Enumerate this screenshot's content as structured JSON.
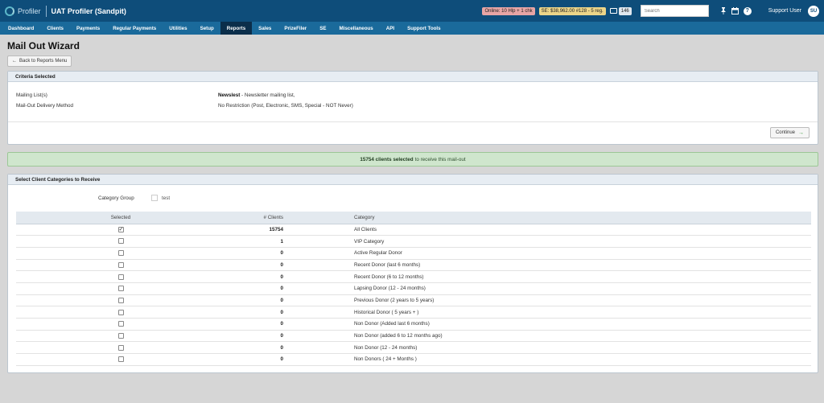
{
  "topbar": {
    "brand": "Profiler",
    "title": "UAT Profiler (Sandpit)",
    "online_badge": "Online: 10 Hlp + 1 chk",
    "se_badge": "SE: $38,962.00 #128 - 5 reg.",
    "message_count": "146",
    "search_placeholder": "Search",
    "user_name": "Support User",
    "user_initials": "SU"
  },
  "nav": {
    "items": [
      "Dashboard",
      "Clients",
      "Payments",
      "Regular Payments",
      "Utilities",
      "Setup",
      "Reports",
      "Sales",
      "PrizeFiler",
      "SE",
      "Miscellaneous",
      "API",
      "Support Tools"
    ],
    "active": "Reports"
  },
  "page": {
    "title": "Mail Out Wizard",
    "back_label": "Back to Reports Menu"
  },
  "criteria": {
    "heading": "Criteria Selected",
    "mailing_label": "Mailing List(s)",
    "mailing_name": "Newslest",
    "mailing_desc": " - Newsletter mailing list,",
    "delivery_label": "Mail-Out Delivery Method",
    "delivery_value": "No Restriction (Post, Electronic, SMS, Special - NOT Never)",
    "continue_label": "Continue"
  },
  "alert": {
    "count_text": "15754 clients selected",
    "rest_text": "to receive this mail-out"
  },
  "categories": {
    "heading": "Select Client Categories to Receive",
    "group_label": "Category Group",
    "group_option": "test",
    "columns": {
      "selected": "Selected",
      "clients": "# Clients",
      "category": "Category"
    },
    "rows": [
      {
        "checked": true,
        "clients": "15754",
        "category": "All Clients"
      },
      {
        "checked": false,
        "clients": "1",
        "category": "VIP Category"
      },
      {
        "checked": false,
        "clients": "0",
        "category": "Active Regular Donor"
      },
      {
        "checked": false,
        "clients": "0",
        "category": "Recent Donor (last 6 months)"
      },
      {
        "checked": false,
        "clients": "0",
        "category": "Recent Donor (6 to 12 months)"
      },
      {
        "checked": false,
        "clients": "0",
        "category": "Lapsing Donor (12 - 24 months)"
      },
      {
        "checked": false,
        "clients": "0",
        "category": "Previous Donor (2 years to 5 years)"
      },
      {
        "checked": false,
        "clients": "0",
        "category": "Historical Donor ( 5 years + )"
      },
      {
        "checked": false,
        "clients": "0",
        "category": "Non Donor (Added last 6 months)"
      },
      {
        "checked": false,
        "clients": "0",
        "category": "Non Donor (added 6 to 12 months ago)"
      },
      {
        "checked": false,
        "clients": "0",
        "category": "Non Donor (12 - 24 months)"
      },
      {
        "checked": false,
        "clients": "0",
        "category": "Non Donors ( 24 + Months )"
      }
    ]
  }
}
